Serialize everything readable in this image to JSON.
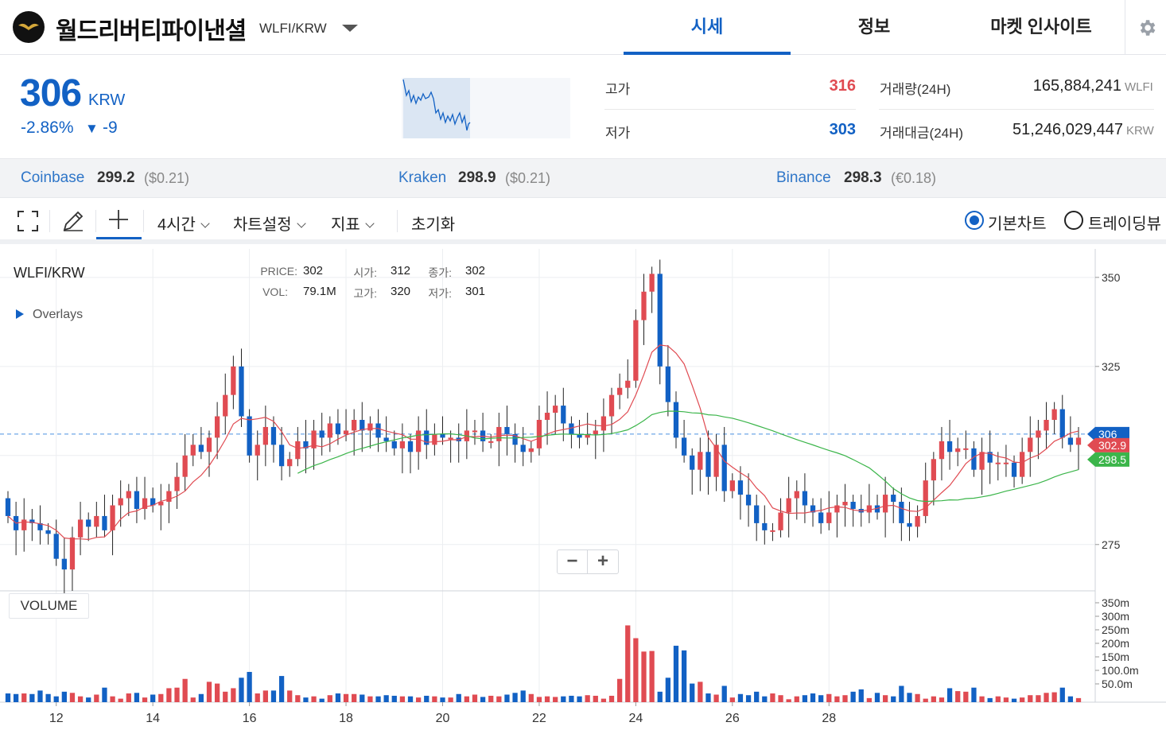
{
  "header": {
    "coin_name": "월드리버티파이낸셜",
    "pair": "WLFI/KRW",
    "tabs": [
      {
        "label": "시세"
      },
      {
        "label": "정보"
      },
      {
        "label": "마켓 인사이트"
      }
    ]
  },
  "price": {
    "current": "306",
    "unit": "KRW",
    "change_pct": "-2.86%",
    "change_arrow": "▼",
    "change_abs": "-9",
    "high_label": "고가",
    "high": "316",
    "low_label": "저가",
    "low": "303",
    "volume_label": "거래량(24H)",
    "volume": "165,884,241",
    "volume_unit": "WLFI",
    "value_label": "거래대금(24H)",
    "value": "51,246,029,447",
    "value_unit": "KRW"
  },
  "exchanges": [
    {
      "name": "Coinbase",
      "price": "299.2",
      "usd": "($0.21)"
    },
    {
      "name": "Kraken",
      "price": "298.9",
      "usd": "($0.21)"
    },
    {
      "name": "Binance",
      "price": "298.3",
      "usd": "(€0.18)"
    }
  ],
  "toolbar": {
    "interval": "4시간",
    "chart_settings": "차트설정",
    "indicators": "지표",
    "reset": "초기화",
    "basic_chart": "기본차트",
    "tradingview": "트레이딩뷰"
  },
  "chart": {
    "pair": "WLFI/KRW",
    "overlays": "Overlays",
    "volume_label": "VOLUME",
    "ohlc": {
      "price_k": "PRICE:",
      "price_v": "302",
      "open_k": "시가:",
      "open_v": "312",
      "close_k": "종가:",
      "close_v": "302",
      "vol_k": "VOL:",
      "vol_v": "79.1M",
      "high_k": "고가:",
      "high_v": "320",
      "low_k": "저가:",
      "low_v": "301"
    },
    "zoom_out": "−",
    "zoom_in": "+",
    "price_ticks": [
      "350",
      "325",
      "275"
    ],
    "volume_ticks": [
      "350m",
      "300m",
      "250m",
      "200m",
      "150m",
      "100.0m",
      "50.0m"
    ],
    "date_ticks": [
      "12",
      "14",
      "16",
      "18",
      "20",
      "22",
      "24",
      "26",
      "28"
    ],
    "markers": [
      {
        "label": "306",
        "color": "#1261c4"
      },
      {
        "label": "302.9",
        "color": "#e04b52"
      },
      {
        "label": "298.5",
        "color": "#3bb54a"
      }
    ]
  },
  "chart_data": {
    "type": "candlestick",
    "title": "WLFI/KRW",
    "interval": "4시간",
    "ylim": [
      262,
      358
    ],
    "ma_colors": {
      "fast": "#e04b52",
      "slow": "#3bb54a"
    },
    "up_color": "#e04b52",
    "down_color": "#1261c4",
    "current_price": 306,
    "ma_fast_last": 302.9,
    "ma_slow_last": 298.5,
    "closes": [
      283,
      279,
      282,
      281,
      279,
      278,
      271,
      268,
      277,
      282,
      280,
      283,
      279,
      286,
      288,
      290,
      285,
      288,
      286,
      287,
      290,
      294,
      300,
      303,
      301,
      305,
      311,
      317,
      325,
      311,
      300,
      303,
      308,
      303,
      297,
      299,
      304,
      302,
      307,
      305,
      309,
      306,
      307,
      310,
      307,
      309,
      305,
      304,
      302,
      304,
      301,
      307,
      303,
      306,
      305,
      305,
      304,
      307,
      307,
      304,
      304,
      308,
      306,
      303,
      301,
      302,
      310,
      312,
      314,
      309,
      306,
      305,
      306,
      307,
      311,
      317,
      319,
      321,
      338,
      346,
      351,
      325,
      315,
      305,
      300,
      296,
      301,
      294,
      303,
      290,
      293,
      289,
      286,
      281,
      279,
      279,
      284,
      288,
      290,
      286,
      284,
      281,
      284,
      286,
      287,
      285,
      284,
      286,
      284,
      289,
      287,
      281,
      280,
      283,
      293,
      299,
      304,
      301,
      302,
      302,
      296,
      301,
      298,
      298,
      298,
      294,
      301,
      305,
      307,
      310,
      313,
      305,
      303,
      305
    ],
    "volumes": [
      15,
      14,
      15,
      14,
      20,
      14,
      10,
      18,
      16,
      10,
      8,
      13,
      25,
      10,
      6,
      15,
      16,
      8,
      13,
      14,
      24,
      25,
      40,
      8,
      14,
      35,
      32,
      18,
      24,
      42,
      52,
      15,
      20,
      20,
      45,
      20,
      12,
      8,
      10,
      6,
      12,
      15,
      14,
      14,
      13,
      10,
      10,
      12,
      11,
      10,
      10,
      8,
      11,
      10,
      8,
      8,
      14,
      10,
      13,
      9,
      11,
      10,
      13,
      16,
      20,
      14,
      9,
      10,
      9,
      10,
      11,
      10,
      12,
      11,
      6,
      11,
      40,
      132,
      110,
      87,
      88,
      18,
      42,
      97,
      89,
      32,
      35,
      15,
      13,
      28,
      8,
      14,
      12,
      18,
      10,
      15,
      12,
      5,
      10,
      12,
      15,
      12,
      14,
      10,
      12,
      18,
      22,
      7,
      16,
      12,
      10,
      28,
      16,
      14,
      6,
      10,
      8,
      24,
      19,
      18,
      25,
      10,
      7,
      10,
      8,
      6,
      8,
      12,
      12,
      16,
      17,
      25,
      10,
      7,
      8,
      9
    ],
    "opens": [
      288,
      283,
      279,
      282,
      281,
      279,
      278,
      271,
      268,
      277,
      282,
      280,
      283,
      279,
      286,
      288,
      290,
      285,
      288,
      286,
      287,
      290,
      294,
      300,
      303,
      301,
      305,
      311,
      317,
      325,
      311,
      300,
      303,
      308,
      303,
      297,
      299,
      304,
      302,
      307,
      305,
      309,
      306,
      307,
      310,
      307,
      309,
      305,
      304,
      302,
      304,
      301,
      307,
      303,
      306,
      305,
      305,
      304,
      307,
      307,
      304,
      304,
      308,
      306,
      303,
      301,
      302,
      310,
      312,
      314,
      309,
      306,
      305,
      306,
      307,
      311,
      317,
      319,
      321,
      338,
      346,
      351,
      325,
      315,
      305,
      300,
      296,
      301,
      294,
      303,
      290,
      293,
      289,
      286,
      281,
      279,
      279,
      284,
      288,
      290,
      286,
      284,
      281,
      284,
      286,
      287,
      285,
      284,
      286,
      284,
      289,
      287,
      281,
      280,
      283,
      293,
      299,
      304,
      301,
      302,
      302,
      296,
      301,
      298,
      298,
      298,
      294,
      301,
      305,
      307,
      310,
      313,
      305,
      303
    ],
    "x_labels": [
      "12",
      "14",
      "16",
      "18",
      "20",
      "22",
      "24",
      "26",
      "28"
    ]
  }
}
